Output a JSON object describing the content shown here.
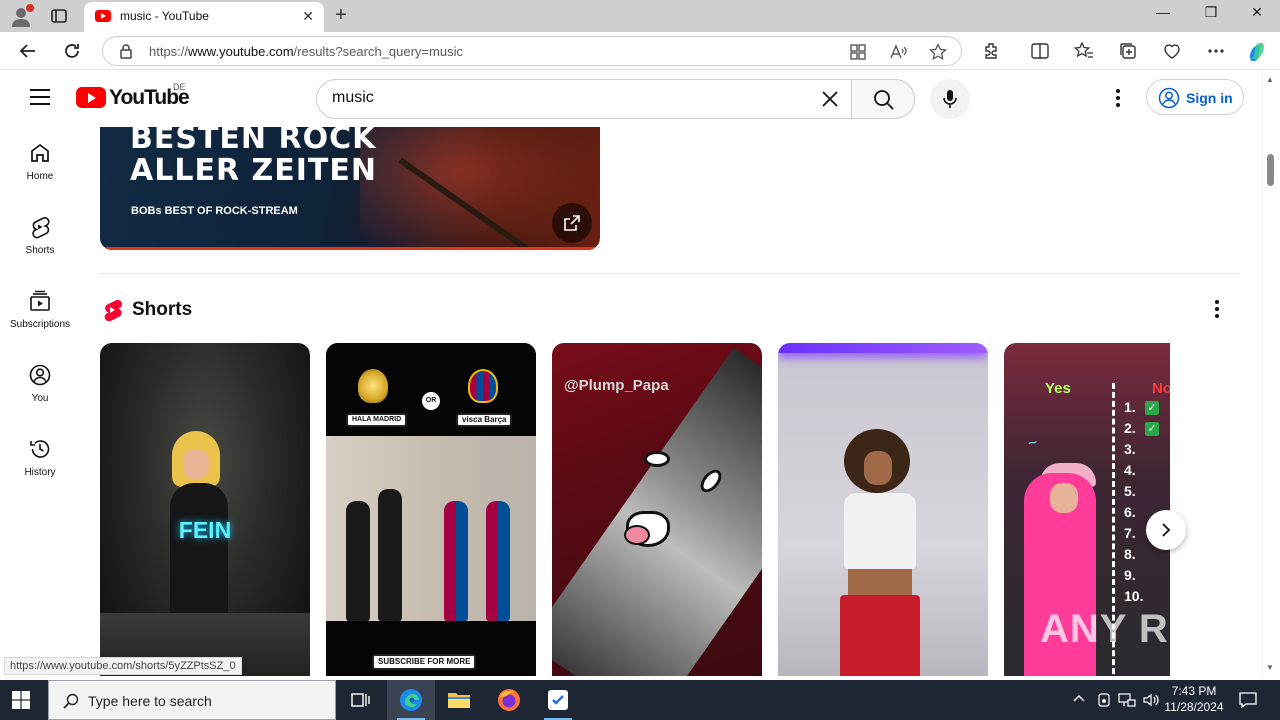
{
  "browser": {
    "tab_title": "music - YouTube",
    "url_prefix": "https://",
    "url_domain": "www.youtube.com",
    "url_path": "/results?search_query=music"
  },
  "youtube": {
    "logo_text": "YouTube",
    "country_code": "DE",
    "search_query": "music",
    "signin_label": "Sign in",
    "sidebar": [
      {
        "label": "Home",
        "icon": "home-icon"
      },
      {
        "label": "Shorts",
        "icon": "shorts-icon"
      },
      {
        "label": "Subscriptions",
        "icon": "subscriptions-icon"
      },
      {
        "label": "You",
        "icon": "you-icon"
      },
      {
        "label": "History",
        "icon": "history-icon"
      }
    ],
    "banner": {
      "line1": "BESTEN ROCK",
      "line2": "ALLER ZEITEN",
      "subtitle": "BOBs BEST OF ROCK-STREAM"
    },
    "shorts_section_title": "Shorts",
    "shorts": [
      {
        "overlay_text": "FEIN"
      },
      {
        "left_label": "HALA MADRID",
        "or_label": "OR",
        "right_label": "visca Barça",
        "bottom_label": "SUBSCRIBE FOR MORE"
      },
      {
        "overlay_text": "@Plump_Papa"
      },
      {
        "overlay_text": ""
      },
      {
        "yes_label": "Yes",
        "no_label": "No",
        "numbers": [
          "1.",
          "2.",
          "3.",
          "4.",
          "5.",
          "6.",
          "7.",
          "8.",
          "9.",
          "10."
        ]
      }
    ],
    "status_url": "https://www.youtube.com/shorts/5yZZPtsSZ_0",
    "watermark": "ANY RUN"
  },
  "taskbar": {
    "search_placeholder": "Type here to search",
    "time": "7:43 PM",
    "date": "11/28/2024"
  },
  "colors": {
    "youtube_red": "#ff0000",
    "link_blue": "#065fd4",
    "taskbar_bg": "#1f2633"
  }
}
